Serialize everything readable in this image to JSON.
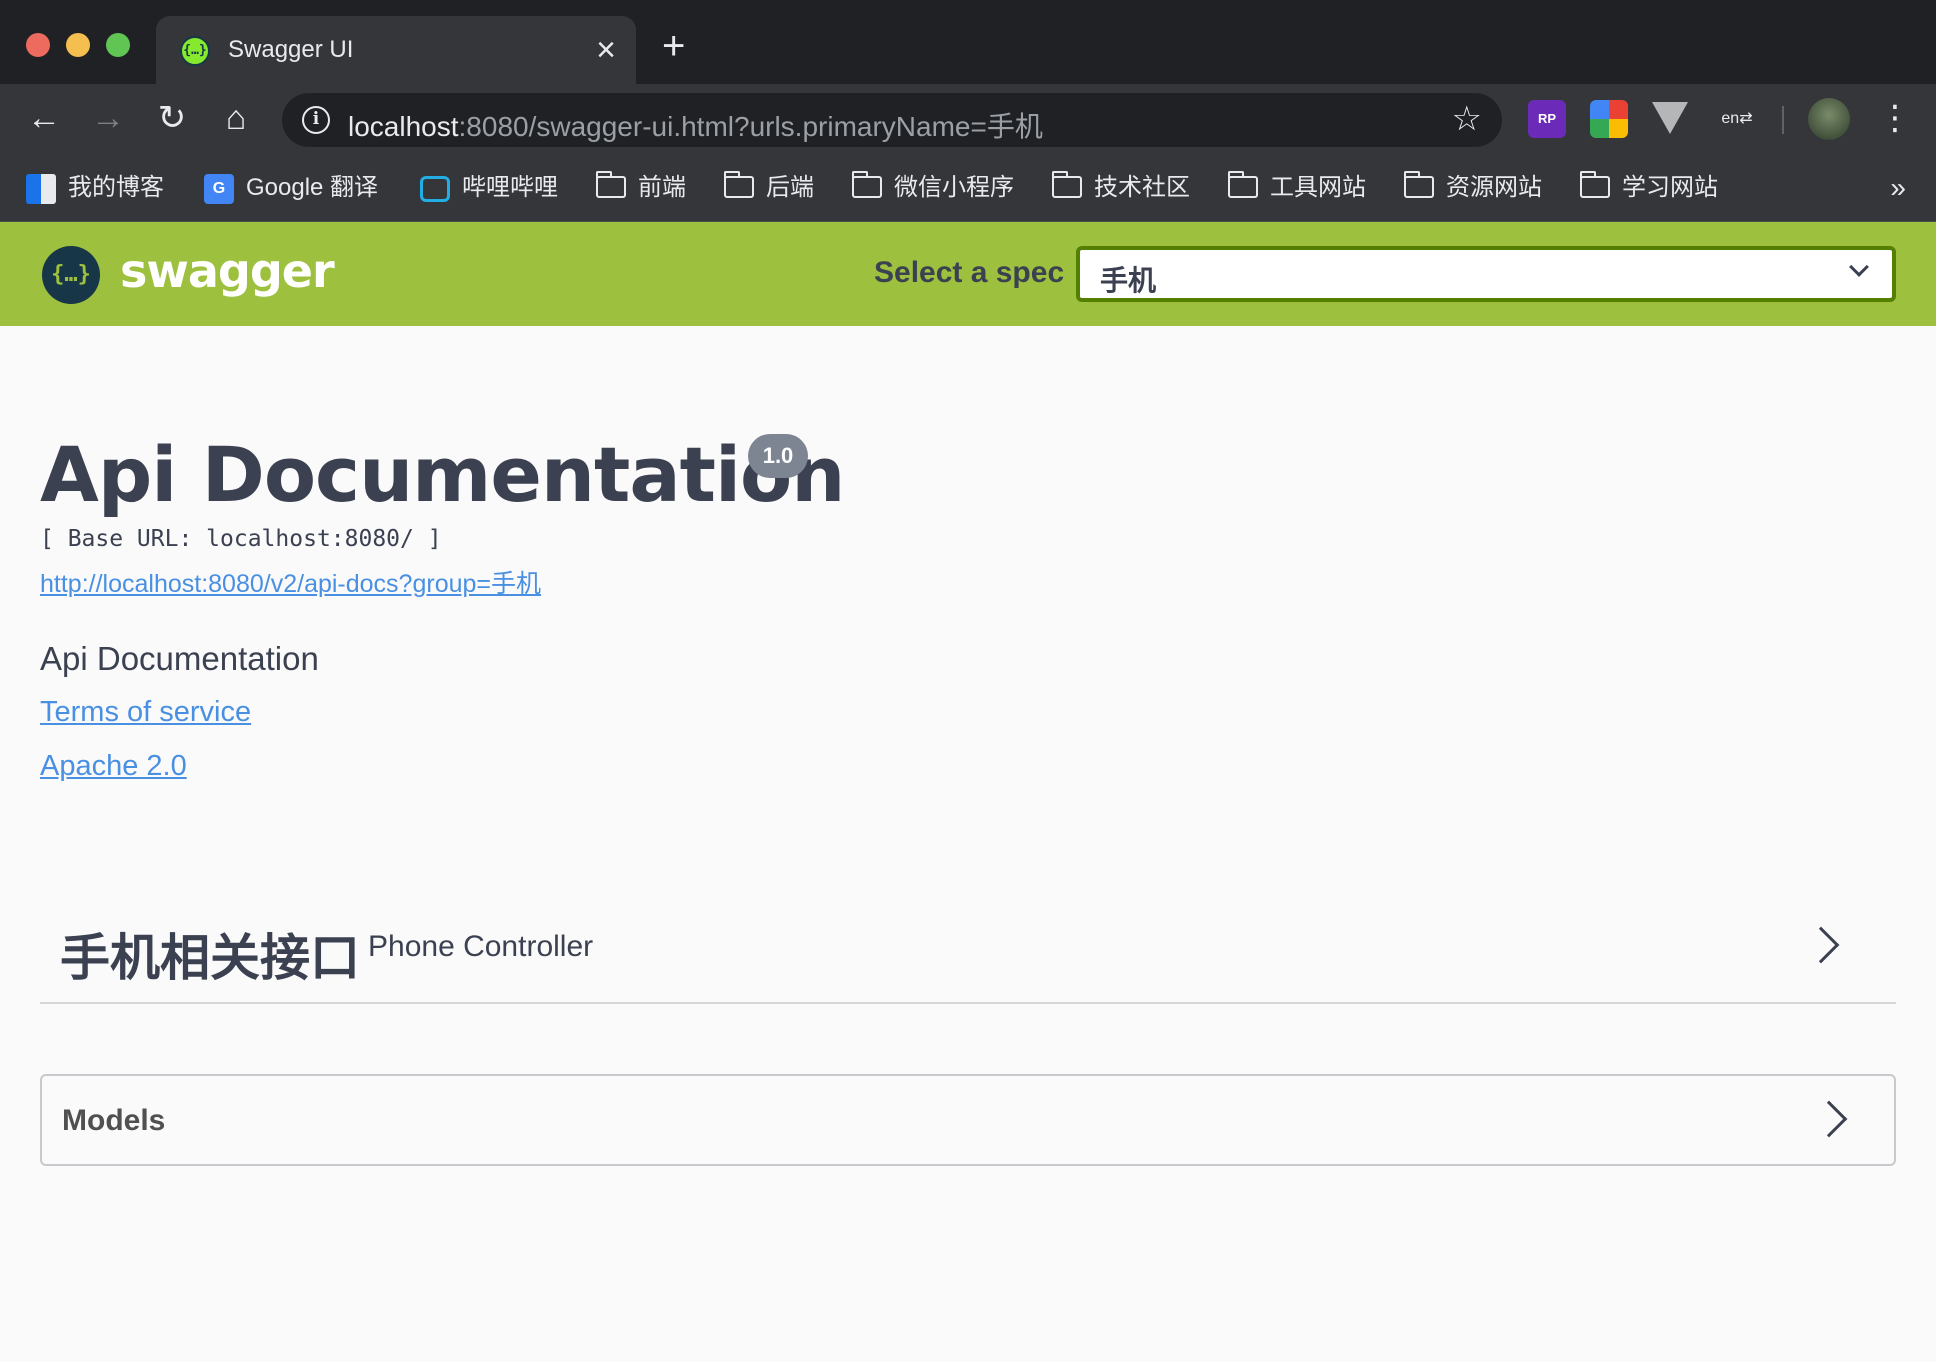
{
  "browser": {
    "tab_title": "Swagger UI",
    "tab_favicon": "{…}",
    "url_host": "localhost",
    "url_rest": ":8080/swagger-ui.html?urls.primaryName=手机",
    "extensions": {
      "rp_label": "RP"
    },
    "bookmarks": [
      {
        "label": "我的博客",
        "icon": "blog-icon"
      },
      {
        "label": "Google 翻译",
        "icon": "google-translate-icon"
      },
      {
        "label": "哔哩哔哩",
        "icon": "bilibili-icon"
      },
      {
        "label": "前端",
        "icon": "folder-icon"
      },
      {
        "label": "后端",
        "icon": "folder-icon"
      },
      {
        "label": "微信小程序",
        "icon": "folder-icon"
      },
      {
        "label": "技术社区",
        "icon": "folder-icon"
      },
      {
        "label": "工具网站",
        "icon": "folder-icon"
      },
      {
        "label": "资源网站",
        "icon": "folder-icon"
      },
      {
        "label": "学习网站",
        "icon": "folder-icon"
      }
    ],
    "more_label": "»"
  },
  "topbar": {
    "logo_glyph": "{…}",
    "logo_text": "swagger",
    "spec_label": "Select a spec",
    "spec_selected": "手机"
  },
  "info": {
    "title": "Api Documentation",
    "version": "1.0",
    "base_url": "[ Base URL: localhost:8080/ ]",
    "spec_link": "http://localhost:8080/v2/api-docs?group=手机",
    "description": "Api Documentation",
    "terms_label": "Terms of service",
    "license_label": "Apache 2.0"
  },
  "tags": [
    {
      "name": "手机相关接口",
      "description": "Phone Controller"
    }
  ],
  "models": {
    "title": "Models"
  },
  "colors": {
    "topbar": "#9dc03f",
    "text": "#3b4151",
    "link": "#4990e2",
    "badge": "#7d8492"
  }
}
